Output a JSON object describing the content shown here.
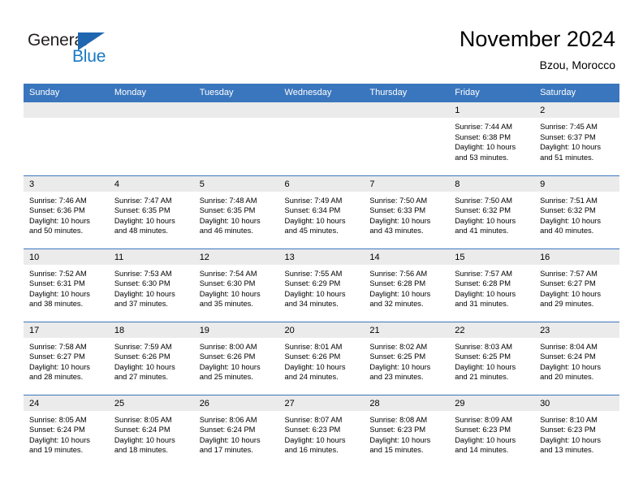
{
  "brand": {
    "name_part1": "General",
    "name_part2": "Blue",
    "triangle_icon": "triangle-icon",
    "colors": {
      "dark": "#231f20",
      "blue": "#1779c4",
      "triangle": "#1f66b0"
    }
  },
  "header": {
    "title": "November 2024",
    "subtitle": "Bzou, Morocco"
  },
  "theme": {
    "header_blue": "#3a76bd",
    "daynum_gray": "#ebebeb",
    "row_border": "#3a76bd"
  },
  "weekdays": [
    "Sunday",
    "Monday",
    "Tuesday",
    "Wednesday",
    "Thursday",
    "Friday",
    "Saturday"
  ],
  "weeks": [
    [
      {
        "day": "",
        "sunrise": "",
        "sunset": "",
        "daylight_line1": "",
        "daylight_line2": ""
      },
      {
        "day": "",
        "sunrise": "",
        "sunset": "",
        "daylight_line1": "",
        "daylight_line2": ""
      },
      {
        "day": "",
        "sunrise": "",
        "sunset": "",
        "daylight_line1": "",
        "daylight_line2": ""
      },
      {
        "day": "",
        "sunrise": "",
        "sunset": "",
        "daylight_line1": "",
        "daylight_line2": ""
      },
      {
        "day": "",
        "sunrise": "",
        "sunset": "",
        "daylight_line1": "",
        "daylight_line2": ""
      },
      {
        "day": "1",
        "sunrise": "Sunrise: 7:44 AM",
        "sunset": "Sunset: 6:38 PM",
        "daylight_line1": "Daylight: 10 hours",
        "daylight_line2": "and 53 minutes."
      },
      {
        "day": "2",
        "sunrise": "Sunrise: 7:45 AM",
        "sunset": "Sunset: 6:37 PM",
        "daylight_line1": "Daylight: 10 hours",
        "daylight_line2": "and 51 minutes."
      }
    ],
    [
      {
        "day": "3",
        "sunrise": "Sunrise: 7:46 AM",
        "sunset": "Sunset: 6:36 PM",
        "daylight_line1": "Daylight: 10 hours",
        "daylight_line2": "and 50 minutes."
      },
      {
        "day": "4",
        "sunrise": "Sunrise: 7:47 AM",
        "sunset": "Sunset: 6:35 PM",
        "daylight_line1": "Daylight: 10 hours",
        "daylight_line2": "and 48 minutes."
      },
      {
        "day": "5",
        "sunrise": "Sunrise: 7:48 AM",
        "sunset": "Sunset: 6:35 PM",
        "daylight_line1": "Daylight: 10 hours",
        "daylight_line2": "and 46 minutes."
      },
      {
        "day": "6",
        "sunrise": "Sunrise: 7:49 AM",
        "sunset": "Sunset: 6:34 PM",
        "daylight_line1": "Daylight: 10 hours",
        "daylight_line2": "and 45 minutes."
      },
      {
        "day": "7",
        "sunrise": "Sunrise: 7:50 AM",
        "sunset": "Sunset: 6:33 PM",
        "daylight_line1": "Daylight: 10 hours",
        "daylight_line2": "and 43 minutes."
      },
      {
        "day": "8",
        "sunrise": "Sunrise: 7:50 AM",
        "sunset": "Sunset: 6:32 PM",
        "daylight_line1": "Daylight: 10 hours",
        "daylight_line2": "and 41 minutes."
      },
      {
        "day": "9",
        "sunrise": "Sunrise: 7:51 AM",
        "sunset": "Sunset: 6:32 PM",
        "daylight_line1": "Daylight: 10 hours",
        "daylight_line2": "and 40 minutes."
      }
    ],
    [
      {
        "day": "10",
        "sunrise": "Sunrise: 7:52 AM",
        "sunset": "Sunset: 6:31 PM",
        "daylight_line1": "Daylight: 10 hours",
        "daylight_line2": "and 38 minutes."
      },
      {
        "day": "11",
        "sunrise": "Sunrise: 7:53 AM",
        "sunset": "Sunset: 6:30 PM",
        "daylight_line1": "Daylight: 10 hours",
        "daylight_line2": "and 37 minutes."
      },
      {
        "day": "12",
        "sunrise": "Sunrise: 7:54 AM",
        "sunset": "Sunset: 6:30 PM",
        "daylight_line1": "Daylight: 10 hours",
        "daylight_line2": "and 35 minutes."
      },
      {
        "day": "13",
        "sunrise": "Sunrise: 7:55 AM",
        "sunset": "Sunset: 6:29 PM",
        "daylight_line1": "Daylight: 10 hours",
        "daylight_line2": "and 34 minutes."
      },
      {
        "day": "14",
        "sunrise": "Sunrise: 7:56 AM",
        "sunset": "Sunset: 6:28 PM",
        "daylight_line1": "Daylight: 10 hours",
        "daylight_line2": "and 32 minutes."
      },
      {
        "day": "15",
        "sunrise": "Sunrise: 7:57 AM",
        "sunset": "Sunset: 6:28 PM",
        "daylight_line1": "Daylight: 10 hours",
        "daylight_line2": "and 31 minutes."
      },
      {
        "day": "16",
        "sunrise": "Sunrise: 7:57 AM",
        "sunset": "Sunset: 6:27 PM",
        "daylight_line1": "Daylight: 10 hours",
        "daylight_line2": "and 29 minutes."
      }
    ],
    [
      {
        "day": "17",
        "sunrise": "Sunrise: 7:58 AM",
        "sunset": "Sunset: 6:27 PM",
        "daylight_line1": "Daylight: 10 hours",
        "daylight_line2": "and 28 minutes."
      },
      {
        "day": "18",
        "sunrise": "Sunrise: 7:59 AM",
        "sunset": "Sunset: 6:26 PM",
        "daylight_line1": "Daylight: 10 hours",
        "daylight_line2": "and 27 minutes."
      },
      {
        "day": "19",
        "sunrise": "Sunrise: 8:00 AM",
        "sunset": "Sunset: 6:26 PM",
        "daylight_line1": "Daylight: 10 hours",
        "daylight_line2": "and 25 minutes."
      },
      {
        "day": "20",
        "sunrise": "Sunrise: 8:01 AM",
        "sunset": "Sunset: 6:26 PM",
        "daylight_line1": "Daylight: 10 hours",
        "daylight_line2": "and 24 minutes."
      },
      {
        "day": "21",
        "sunrise": "Sunrise: 8:02 AM",
        "sunset": "Sunset: 6:25 PM",
        "daylight_line1": "Daylight: 10 hours",
        "daylight_line2": "and 23 minutes."
      },
      {
        "day": "22",
        "sunrise": "Sunrise: 8:03 AM",
        "sunset": "Sunset: 6:25 PM",
        "daylight_line1": "Daylight: 10 hours",
        "daylight_line2": "and 21 minutes."
      },
      {
        "day": "23",
        "sunrise": "Sunrise: 8:04 AM",
        "sunset": "Sunset: 6:24 PM",
        "daylight_line1": "Daylight: 10 hours",
        "daylight_line2": "and 20 minutes."
      }
    ],
    [
      {
        "day": "24",
        "sunrise": "Sunrise: 8:05 AM",
        "sunset": "Sunset: 6:24 PM",
        "daylight_line1": "Daylight: 10 hours",
        "daylight_line2": "and 19 minutes."
      },
      {
        "day": "25",
        "sunrise": "Sunrise: 8:05 AM",
        "sunset": "Sunset: 6:24 PM",
        "daylight_line1": "Daylight: 10 hours",
        "daylight_line2": "and 18 minutes."
      },
      {
        "day": "26",
        "sunrise": "Sunrise: 8:06 AM",
        "sunset": "Sunset: 6:24 PM",
        "daylight_line1": "Daylight: 10 hours",
        "daylight_line2": "and 17 minutes."
      },
      {
        "day": "27",
        "sunrise": "Sunrise: 8:07 AM",
        "sunset": "Sunset: 6:23 PM",
        "daylight_line1": "Daylight: 10 hours",
        "daylight_line2": "and 16 minutes."
      },
      {
        "day": "28",
        "sunrise": "Sunrise: 8:08 AM",
        "sunset": "Sunset: 6:23 PM",
        "daylight_line1": "Daylight: 10 hours",
        "daylight_line2": "and 15 minutes."
      },
      {
        "day": "29",
        "sunrise": "Sunrise: 8:09 AM",
        "sunset": "Sunset: 6:23 PM",
        "daylight_line1": "Daylight: 10 hours",
        "daylight_line2": "and 14 minutes."
      },
      {
        "day": "30",
        "sunrise": "Sunrise: 8:10 AM",
        "sunset": "Sunset: 6:23 PM",
        "daylight_line1": "Daylight: 10 hours",
        "daylight_line2": "and 13 minutes."
      }
    ]
  ]
}
